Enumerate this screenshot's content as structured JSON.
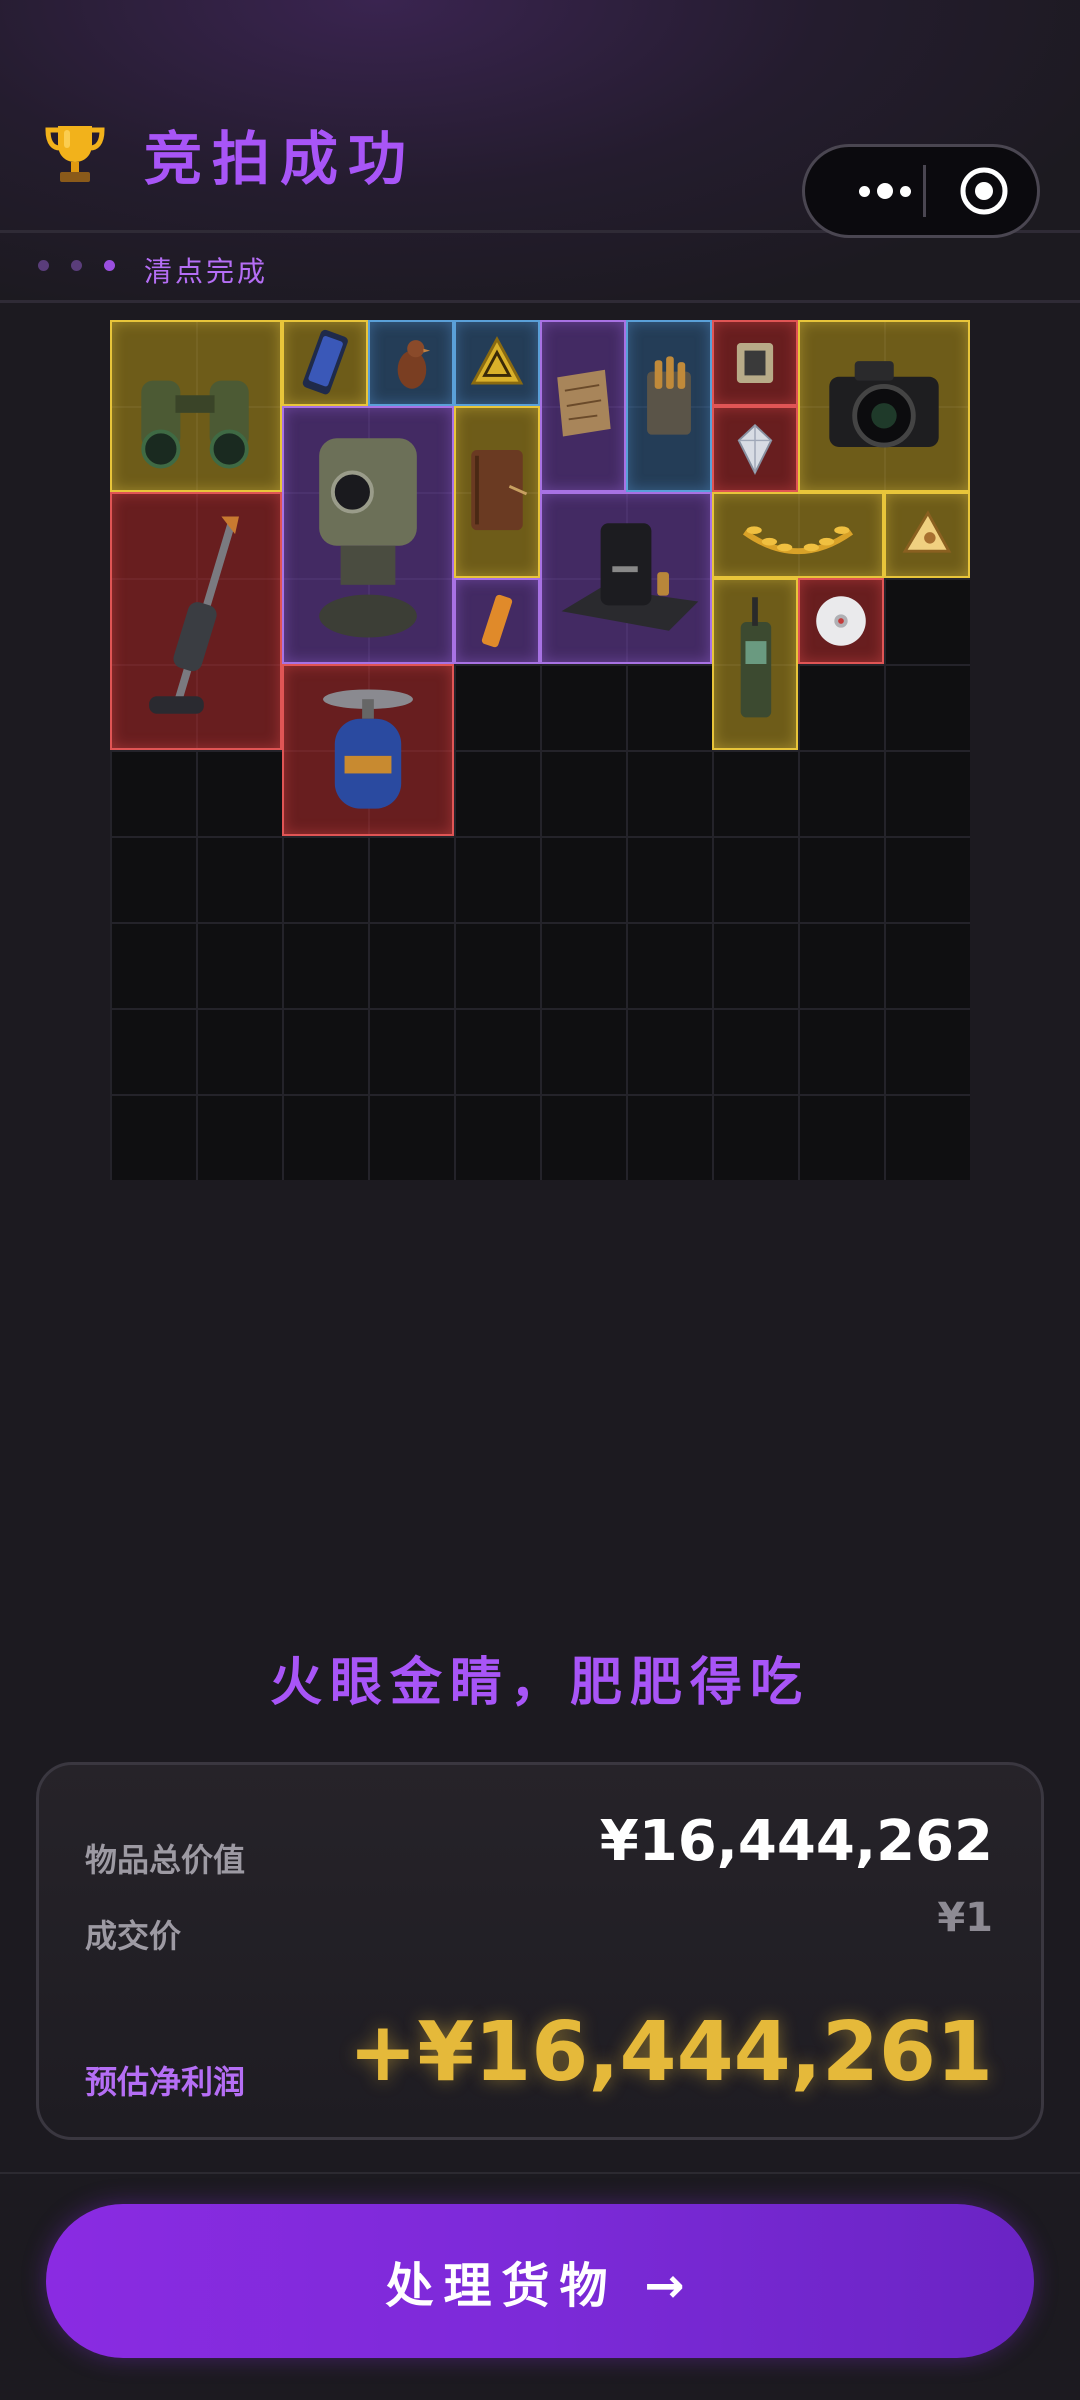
{
  "header": {
    "title": "竞拍成功",
    "title_icon": "trophy-icon"
  },
  "capsule": {
    "more_icon": "more-dots-icon",
    "close_icon": "target-circle-icon"
  },
  "progress": {
    "step_dots": 3,
    "active_step": 3,
    "status_text": "清点完成"
  },
  "inventory": {
    "grid_columns": 10,
    "grid_rows": 10,
    "items": [
      {
        "name": "binoculars",
        "rarity": "gold"
      },
      {
        "name": "smartphone",
        "rarity": "gold"
      },
      {
        "name": "bird-figurine",
        "rarity": "blue"
      },
      {
        "name": "warning-sign",
        "rarity": "blue"
      },
      {
        "name": "old-map",
        "rarity": "purple"
      },
      {
        "name": "ammo-crate",
        "rarity": "blue"
      },
      {
        "name": "circuit-chip",
        "rarity": "red"
      },
      {
        "name": "camera",
        "rarity": "gold"
      },
      {
        "name": "diamond",
        "rarity": "red"
      },
      {
        "name": "vacuum-cleaner",
        "rarity": "red"
      },
      {
        "name": "turret-robot",
        "rarity": "purple"
      },
      {
        "name": "leather-notebook",
        "rarity": "gold"
      },
      {
        "name": "coffee-machine",
        "rarity": "purple"
      },
      {
        "name": "laurel-wreath",
        "rarity": "gold"
      },
      {
        "name": "cheese-wedge",
        "rarity": "gold"
      },
      {
        "name": "candy-bar",
        "rarity": "purple"
      },
      {
        "name": "walkie-talkie",
        "rarity": "gold"
      },
      {
        "name": "cd-disc",
        "rarity": "red"
      },
      {
        "name": "gas-canister",
        "rarity": "red"
      }
    ],
    "rarity_colors": {
      "gold": "#e8c53a",
      "red": "#e05555",
      "purple": "#a872e4",
      "blue": "#5aa0d8"
    }
  },
  "slogan": "火眼金睛，肥肥得吃",
  "summary": {
    "total_label": "物品总价值",
    "total_value": "¥16,444,262",
    "deal_label": "成交价",
    "deal_value": "¥1",
    "profit_label": "预估净利润",
    "profit_value": "+¥16,444,261",
    "profit_color": "#e5b93a"
  },
  "cta": {
    "label": "处理货物 →",
    "color": "#8a2be2"
  }
}
